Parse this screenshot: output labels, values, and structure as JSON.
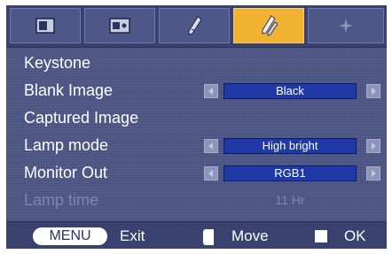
{
  "tabs": [
    {
      "icon": "picture-icon",
      "active": false
    },
    {
      "icon": "screen-icon",
      "active": false
    },
    {
      "icon": "tools-icon",
      "active": false
    },
    {
      "icon": "settings-icon",
      "active": true
    },
    {
      "icon": "star-icon",
      "active": false
    }
  ],
  "menu": {
    "keystone": {
      "label": "Keystone"
    },
    "blank_image": {
      "label": "Blank Image",
      "value": "Black"
    },
    "captured_image": {
      "label": "Captured Image"
    },
    "lamp_mode": {
      "label": "Lamp mode",
      "value": "High bright"
    },
    "monitor_out": {
      "label": "Monitor Out",
      "value": "RGB1"
    },
    "lamp_time": {
      "label": "Lamp time",
      "value": "11 Hr"
    }
  },
  "footer": {
    "menu_key": "MENU",
    "exit_label": "Exit",
    "move_label": "Move",
    "ok_label": "OK"
  },
  "colors": {
    "panel": "#4d5685",
    "tab_active": "#f2b232",
    "value_box": "#1f3aa6",
    "disabled_text": "#7d86ae"
  }
}
